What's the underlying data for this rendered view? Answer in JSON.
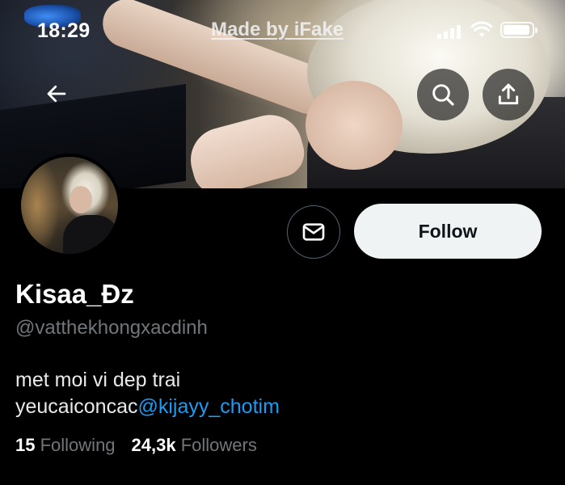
{
  "status_bar": {
    "time": "18:29",
    "watermark": "Made by iFake"
  },
  "banner": {
    "back_icon": "arrow-left-icon",
    "search_icon": "search-icon",
    "share_icon": "share-icon"
  },
  "profile": {
    "display_name": "Kisaa_Đz",
    "handle": "@vatthekhongxacdinh",
    "bio_line1": "met moi vi dep trai",
    "bio_line2_prefix": "yeucaiconcac",
    "bio_mention": "@kijayy_chotim",
    "following_count": "15",
    "following_label": "Following",
    "followers_count": "24,3k",
    "followers_label": "Followers"
  },
  "actions": {
    "message_icon": "envelope-icon",
    "follow_label": "Follow"
  },
  "colors": {
    "background": "#000000",
    "link": "#1d9bf0",
    "muted": "#71767b",
    "follow_bg": "#eff3f4"
  }
}
